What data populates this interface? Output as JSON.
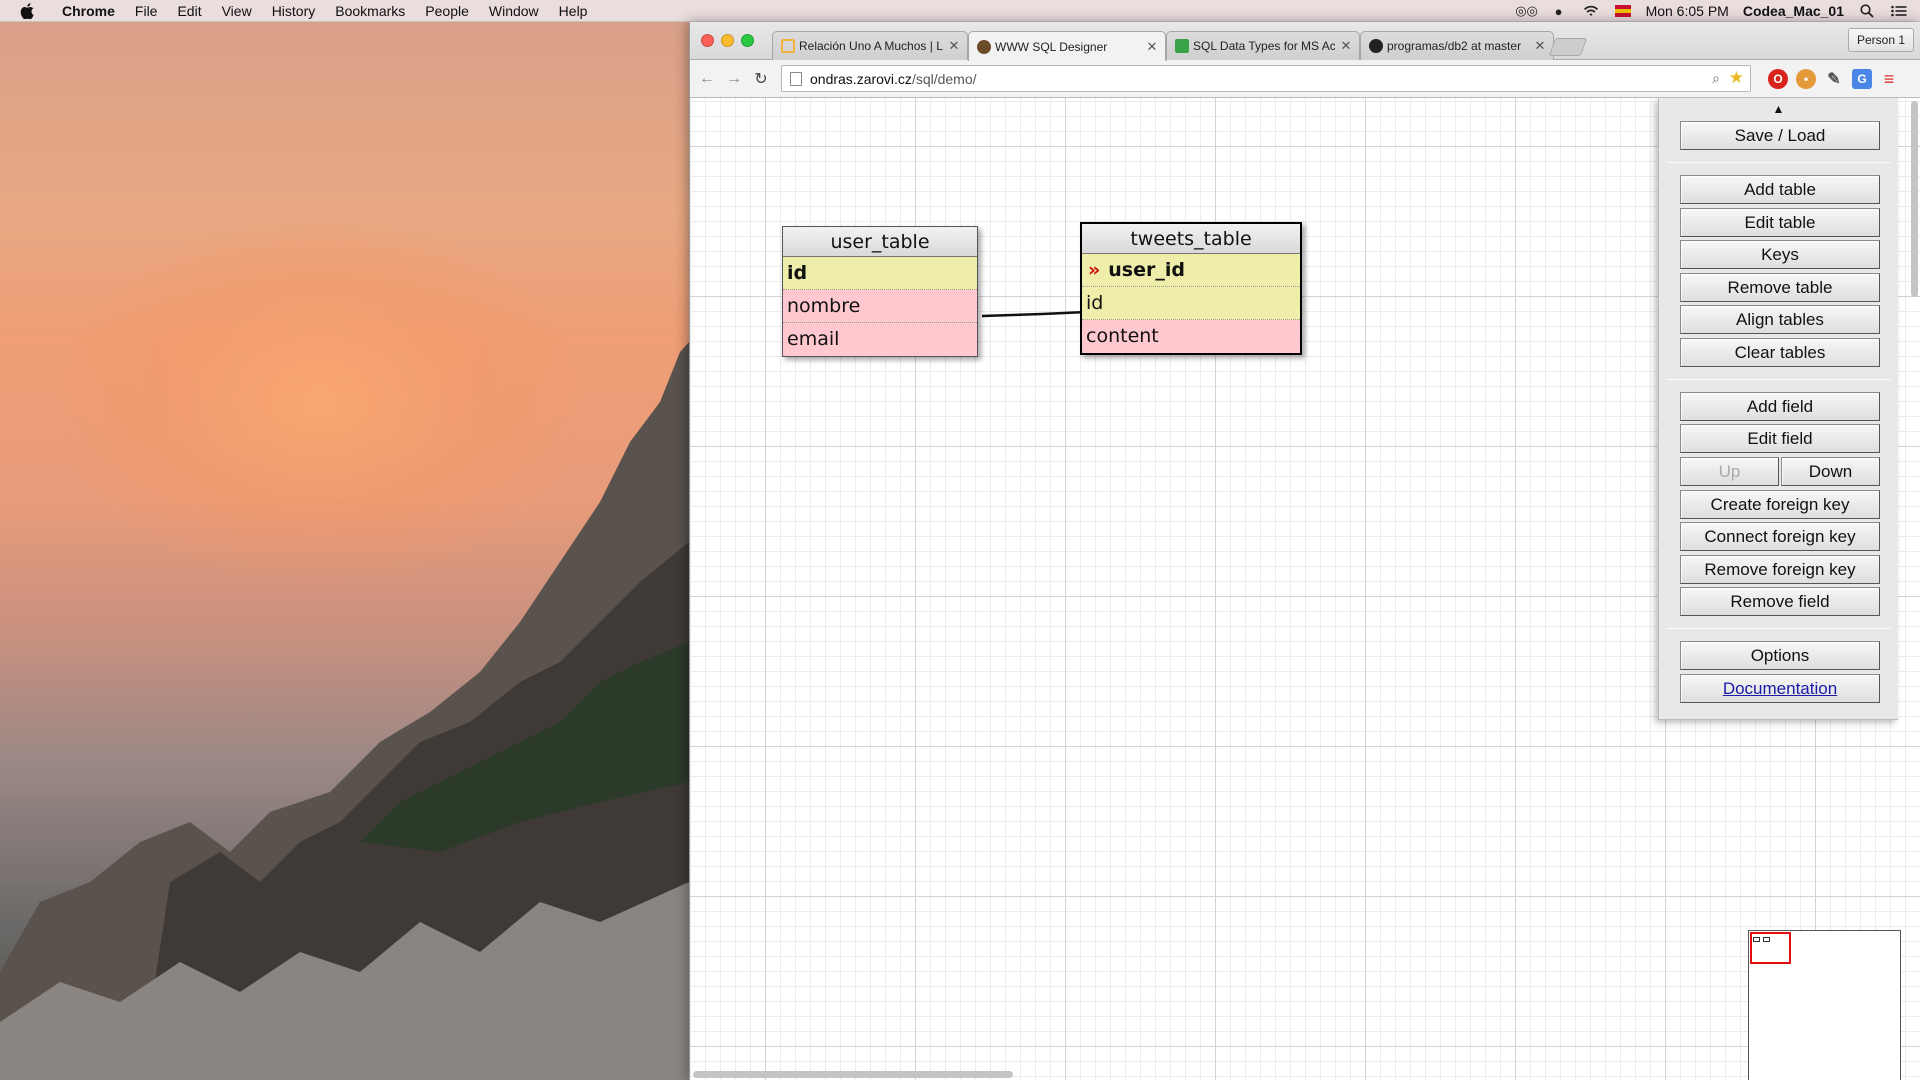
{
  "menubar": {
    "app_name": "Chrome",
    "items": [
      "File",
      "Edit",
      "View",
      "History",
      "Bookmarks",
      "People",
      "Window",
      "Help"
    ],
    "clock": "Mon 6:05 PM",
    "user": "Codea_Mac_01"
  },
  "browser": {
    "tabs": [
      {
        "title": "Relación Uno A Muchos | L",
        "favicon_color": "#f2b33d"
      },
      {
        "title": "WWW SQL Designer",
        "favicon_color": "#6b4b2a"
      },
      {
        "title": "SQL Data Types for MS Ac",
        "favicon_color": "#3aa34a"
      },
      {
        "title": "programas/db2 at master",
        "favicon_color": "#222222"
      }
    ],
    "active_tab": 1,
    "profile": "Person 1",
    "url_host": "ondras.zarovi.cz",
    "url_path": "/sql/demo/"
  },
  "designer": {
    "tables": [
      {
        "name": "user_table",
        "rows": [
          {
            "label": "id",
            "kind": "key",
            "bold": true,
            "fk": false
          },
          {
            "label": "nombre",
            "kind": "plain",
            "bold": false,
            "fk": false
          },
          {
            "label": "email",
            "kind": "plain",
            "bold": false,
            "fk": false
          }
        ]
      },
      {
        "name": "tweets_table",
        "rows": [
          {
            "label": "user_id",
            "kind": "key",
            "bold": true,
            "fk": true
          },
          {
            "label": "id",
            "kind": "key",
            "bold": false,
            "fk": false
          },
          {
            "label": "content",
            "kind": "plain",
            "bold": false,
            "fk": false
          }
        ]
      }
    ],
    "controls": {
      "toggle_icon": "triangle-up-icon",
      "save_load": "Save / Load",
      "add_table": "Add table",
      "edit_table": "Edit table",
      "keys": "Keys",
      "remove_table": "Remove table",
      "align_tables": "Align tables",
      "clear_tables": "Clear tables",
      "add_field": "Add field",
      "edit_field": "Edit field",
      "up": "Up",
      "down": "Down",
      "create_fk": "Create foreign key",
      "connect_fk": "Connect foreign key",
      "remove_fk": "Remove foreign key",
      "remove_field": "Remove field",
      "options": "Options",
      "documentation": "Documentation"
    }
  },
  "colors": {
    "key_row": "#eeeeaa",
    "plain_row": "#ffc8cf",
    "fk_marker": "#d01010",
    "minimap_view": "#e01010"
  }
}
